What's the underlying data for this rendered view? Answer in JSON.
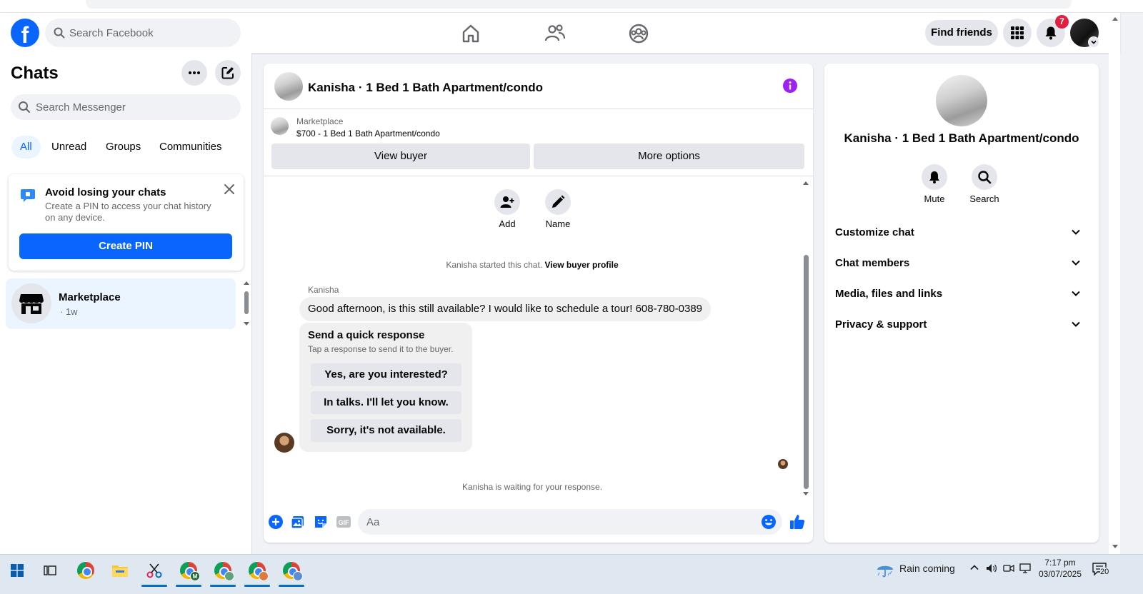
{
  "topnav": {
    "search_placeholder": "Search Facebook",
    "find_friends": "Find friends",
    "notification_count": "7",
    "brand_color": "#0866ff"
  },
  "left": {
    "title": "Chats",
    "search_placeholder": "Search Messenger",
    "filters": [
      "All",
      "Unread",
      "Groups",
      "Communities"
    ],
    "pin_card": {
      "title": "Avoid losing your chats",
      "description": "Create a PIN to access your chat history on any device.",
      "button": "Create PIN"
    },
    "conversation": {
      "name": "Marketplace",
      "time": "· 1w"
    }
  },
  "chat": {
    "title": "Kanisha · 1 Bed 1 Bath Apartment/condo",
    "marketplace_label": "Marketplace",
    "listing": "$700 - 1 Bed 1 Bath Apartment/condo",
    "view_buyer": "View buyer",
    "more_options": "More options",
    "actions": {
      "add": "Add",
      "name": "Name"
    },
    "started_text": "Kanisha started this chat.",
    "view_profile": "View buyer profile",
    "sender": "Kanisha",
    "message": "Good afternoon, is this still available? I would like to schedule a tour! 608-780-0389",
    "quick_response": {
      "title": "Send a quick response",
      "subtitle": "Tap a response to send it to the buyer.",
      "options": [
        "Yes, are you interested?",
        "In talks. I'll let you know.",
        "Sorry, it's not available."
      ]
    },
    "waiting_text": "Kanisha is waiting for your response.",
    "composer_placeholder": "Aa",
    "gif_label": "GIF"
  },
  "details": {
    "name": "Kanisha · 1 Bed 1 Bath Apartment/condo",
    "mute": "Mute",
    "search": "Search",
    "sections": [
      "Customize chat",
      "Chat members",
      "Media, files and links",
      "Privacy & support"
    ]
  },
  "taskbar": {
    "weather": "Rain coming",
    "time": "7:17 pm",
    "date": "03/07/2025",
    "notification_count": "20",
    "profile_badges": [
      "M"
    ]
  }
}
